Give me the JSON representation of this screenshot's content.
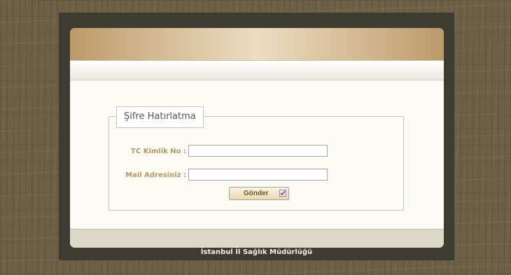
{
  "form": {
    "legend": "Şifre Hatırlatma",
    "tc_label": "TC Kimlik No :",
    "tc_value": "",
    "mail_label": "Mail Adresiniz :",
    "mail_value": "",
    "submit_label": "Gönder",
    "submit_icon": "checkmark-icon"
  },
  "footer": {
    "text": "İstanbul İl Sağlık Müdürlüğü"
  },
  "colors": {
    "background": "#6e6044",
    "frame": "#3c3c30",
    "header_gradient_mid": "#ecdcc2",
    "label": "#b09a5e",
    "footer_text": "#f2f0e6"
  }
}
